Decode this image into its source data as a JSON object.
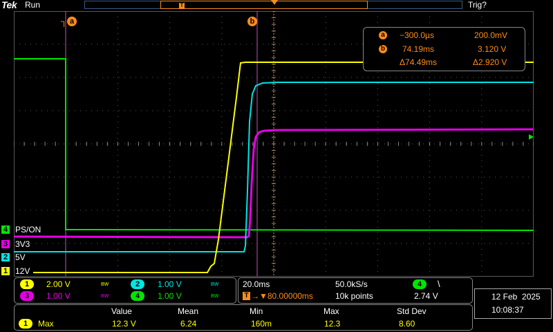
{
  "header": {
    "brand": "Tek",
    "status": "Run",
    "trigger_status": "Trig?",
    "trigger_point_marker": "T"
  },
  "colors": {
    "ch1": "#ffff00",
    "ch2": "#00e5e5",
    "ch3": "#e600e6",
    "ch4": "#00e600",
    "cursor": "#ff8c1a",
    "grid": "#5a5a5a"
  },
  "cursors": {
    "a_label": "a",
    "b_label": "b"
  },
  "readout": {
    "a_time": "−300.0µs",
    "a_value": "200.0mV",
    "b_time": "74.19ms",
    "b_value": "3.120 V",
    "delta_time": "Δ74.49ms",
    "delta_value": "Δ2.920 V"
  },
  "channel_labels": [
    {
      "num": "4",
      "name": "PS/ON"
    },
    {
      "num": "3",
      "name": "3V3"
    },
    {
      "num": "2",
      "name": "5V"
    },
    {
      "num": "1",
      "name": "12V"
    }
  ],
  "vertical_settings": [
    {
      "ch": "1",
      "scale": "2.00 V",
      "bw": "BW"
    },
    {
      "ch": "2",
      "scale": "1.00 V",
      "bw": "BW"
    },
    {
      "ch": "3",
      "scale": "1.00 V",
      "bw": "BW"
    },
    {
      "ch": "4",
      "scale": "1.00 V",
      "bw": "BW"
    }
  ],
  "horizontal": {
    "timebase": "20.0ms",
    "sample_rate": "50.0kS/s",
    "position": "▼80.00000ms",
    "record_length": "10k points"
  },
  "trigger": {
    "source": "4",
    "slope": "\\",
    "level": "2.74 V"
  },
  "datetime": {
    "date": "12 Feb  2025",
    "time": "10:08:37"
  },
  "measurements": {
    "headers": [
      "Value",
      "Mean",
      "Min",
      "Max",
      "Std Dev"
    ],
    "rows": [
      {
        "ch": "1",
        "type": "Max",
        "value": "12.3 V",
        "mean": "6.24",
        "min": "160m",
        "max": "12.3",
        "std": "8.60"
      }
    ]
  }
}
